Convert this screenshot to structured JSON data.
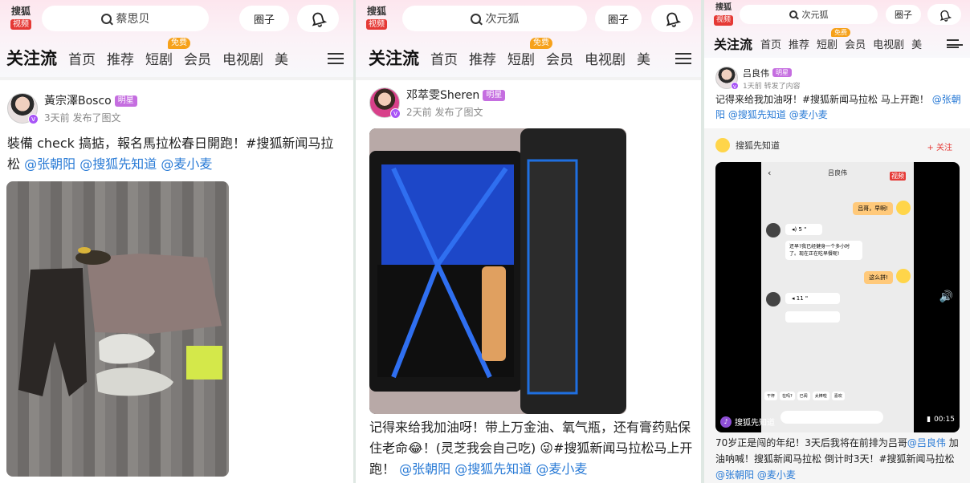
{
  "app": {
    "logo_top": "搜狐",
    "logo_bottom": "视频",
    "circle_label": "圈子"
  },
  "nav": {
    "follow": "关注流",
    "home": "首页",
    "recommend": "推荐",
    "short": "短剧",
    "free_badge": "免费",
    "member": "会员",
    "tv": "电视剧",
    "more": "美"
  },
  "panels": [
    {
      "search_placeholder": "蔡思贝",
      "author": "黃宗澤Bosco",
      "badge": "明星",
      "meta": "3天前 发布了图文",
      "text": "裝備 check 搞掂，報名馬拉松春日開跑！#搜狐新闻马拉松",
      "mentions": [
        "@张朝阳",
        "@搜狐先知道",
        "@麦小麦"
      ]
    },
    {
      "search_placeholder": "次元狐",
      "author": "邓萃雯Sheren",
      "badge": "明星",
      "meta": "2天前 发布了图文",
      "text": "记得来给我加油呀！带上万金油、氧气瓶，还有膏药贴保住老命😂！(灵芝我会自己吃) 😜#搜狐新闻马拉松马上开跑！",
      "mentions": [
        "@张朝阳",
        "@搜狐先知道",
        "@麦小麦"
      ]
    },
    {
      "search_placeholder": "次元狐",
      "author": "吕良伟",
      "badge": "明星",
      "meta": "1天前 转发了内容",
      "text": "记得来给我加油呀！#搜狐新闻马拉松 马上开跑！",
      "mentions": [
        "@张朝阳",
        "@搜狐先知道",
        "@麦小麦"
      ],
      "repost_author": "搜狐先知道",
      "follow_label": "+ 关注",
      "video": {
        "chat_title": "吕良伟",
        "chat_badge": "视频",
        "msg1": "吕哥，早啊!",
        "voice1": "5 \"",
        "msg2": "还早?我已经健身一个多小时了。现在正在吃早餐呢!",
        "msg3": "这么拼!",
        "voice2": "11 \"",
        "duration": "00:15",
        "quick_replies": [
          "干杯",
          "在吗?",
          "已阅",
          "太棒啦",
          "喜欢"
        ],
        "channel": "搜狐先知道"
      },
      "caption": "70岁正是闯的年纪！3天后我将在前排为吕哥",
      "caption_mention": "@吕良伟",
      "caption_rest": " 加油呐喊！搜狐新闻马拉松 倒计时3天！#搜狐新闻马拉松",
      "caption_mentions": [
        "@张朝阳",
        "@麦小麦"
      ]
    }
  ]
}
